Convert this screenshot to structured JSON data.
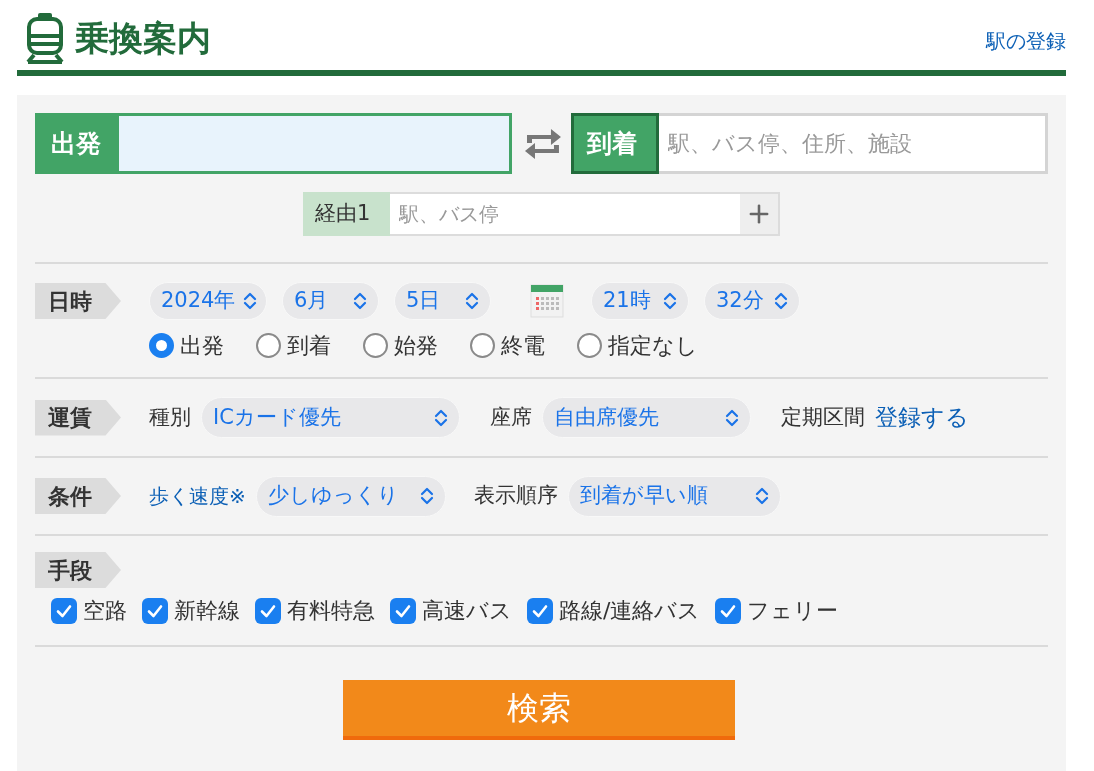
{
  "header": {
    "title": "乗換案内",
    "link": "駅の登録"
  },
  "from": {
    "label": "出発"
  },
  "to": {
    "label": "到着",
    "placeholder": "駅、バス停、住所、施設"
  },
  "via": {
    "label": "経由1",
    "placeholder": "駅、バス停"
  },
  "date_time": {
    "label": "日時",
    "date_selects": [
      {
        "value": "2024年"
      },
      {
        "value": "6月"
      },
      {
        "value": "5日"
      }
    ],
    "time_selects": [
      {
        "value": "21時"
      },
      {
        "value": "32分"
      }
    ],
    "options": [
      {
        "label": "出発",
        "selected": true
      },
      {
        "label": "到着",
        "selected": false
      },
      {
        "label": "始発",
        "selected": false
      },
      {
        "label": "終電",
        "selected": false
      },
      {
        "label": "指定なし",
        "selected": false
      }
    ]
  },
  "fare": {
    "label": "運賃",
    "fields": [
      {
        "label": "種別",
        "value": "ICカード優先"
      },
      {
        "label": "座席",
        "value": "自由席優先"
      }
    ],
    "commuter": {
      "label": "定期区間",
      "link": "登録する"
    }
  },
  "conditions": {
    "label": "条件",
    "fields": [
      {
        "label": "歩く速度※",
        "kind": "link",
        "value": "少しゆっくり"
      },
      {
        "label": "表示順序",
        "kind": "text",
        "value": "到着が早い順"
      }
    ]
  },
  "means": {
    "label": "手段",
    "items": [
      {
        "label": "空路",
        "checked": true
      },
      {
        "label": "新幹線",
        "checked": true
      },
      {
        "label": "有料特急",
        "checked": true
      },
      {
        "label": "高速バス",
        "checked": true
      },
      {
        "label": "路線/連絡バス",
        "checked": true
      },
      {
        "label": "フェリー",
        "checked": true
      }
    ]
  },
  "search_button": "検索"
}
